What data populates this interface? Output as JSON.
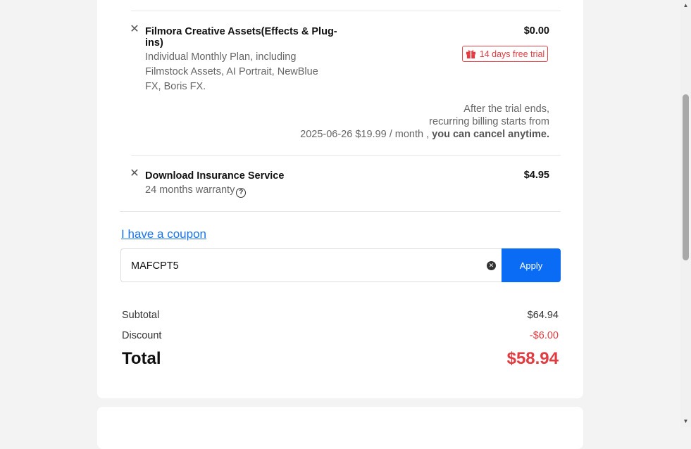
{
  "items": [
    {
      "title_line1": "Filmora Creative Assets(Effects & Plug-",
      "title_line2": "ins)",
      "desc_line1": "Individual Monthly Plan, including",
      "desc_line2": "Filmstock Assets, AI Portrait, NewBlue",
      "desc_line3": "FX, Boris FX.",
      "price": "$0.00",
      "badge": "14 days free trial",
      "trial_line1": "After the trial ends,",
      "trial_line2": "recurring billing starts from",
      "trial_line3_pre": "2025-06-26 $19.99 / month ,",
      "trial_line3_bold": "you can cancel anytime."
    },
    {
      "title": "Download Insurance Service",
      "desc": "24 months warranty",
      "price": "$4.95"
    }
  ],
  "coupon": {
    "link_label": "I have a coupon",
    "value": "MAFCPT5",
    "apply_label": "Apply"
  },
  "summary": {
    "subtotal_label": "Subtotal",
    "subtotal_value": "$64.94",
    "discount_label": "Discount",
    "discount_value": "-$6.00",
    "total_label": "Total",
    "total_value": "$58.94"
  },
  "colors": {
    "accent": "#0a6cf5",
    "discount": "#e23b40",
    "total": "#e23b40"
  },
  "icons": {
    "remove": "close-icon",
    "gift": "gift-icon",
    "help": "help-icon",
    "clear": "clear-input-icon"
  }
}
